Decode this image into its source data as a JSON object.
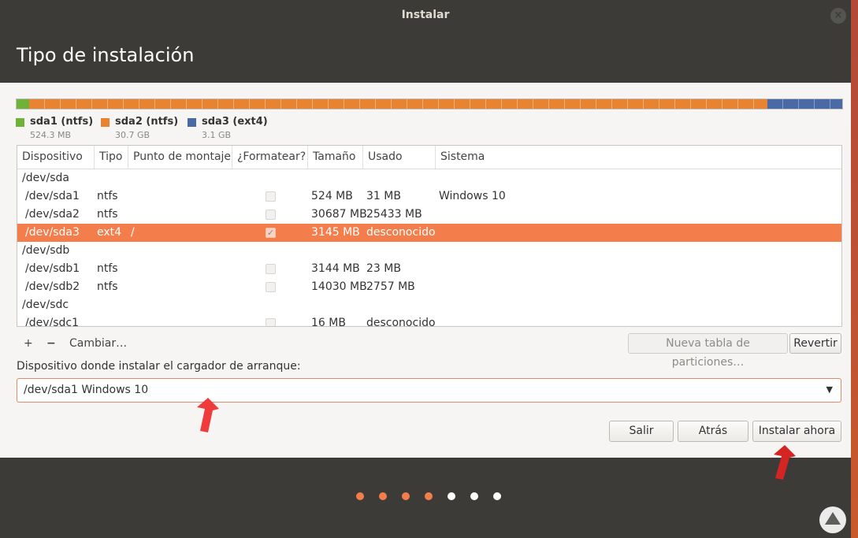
{
  "window": {
    "title": "Instalar",
    "close_glyph": "×"
  },
  "page": {
    "title": "Tipo de instalación"
  },
  "partitions_bar": [
    {
      "name": "sda1 (ntfs)",
      "size": "524.3 MB",
      "color": "#6fb23a",
      "fraction": 0.0152
    },
    {
      "name": "sda2 (ntfs)",
      "size": "30.7 GB",
      "color": "#e88332",
      "fraction": 0.894
    },
    {
      "name": "sda3 (ext4)",
      "size": "3.1 GB",
      "color": "#4a6aa5",
      "fraction": 0.0908
    }
  ],
  "table": {
    "columns": [
      "Dispositivo",
      "Tipo",
      "Punto de montaje",
      "¿Formatear?",
      "Tamaño",
      "Usado",
      "Sistema"
    ],
    "rows": [
      {
        "device": "/dev/sda",
        "group": true
      },
      {
        "device": "/dev/sda1",
        "type": "ntfs",
        "mount": "",
        "format": false,
        "size": "524 MB",
        "used": "31 MB",
        "system": "Windows 10"
      },
      {
        "device": "/dev/sda2",
        "type": "ntfs",
        "mount": "",
        "format": false,
        "size": "30687 MB",
        "used": "25433 MB",
        "system": ""
      },
      {
        "device": "/dev/sda3",
        "type": "ext4",
        "mount": "/",
        "format": true,
        "size": "3145 MB",
        "used": "desconocido",
        "system": "",
        "selected": true
      },
      {
        "device": "/dev/sdb",
        "group": true
      },
      {
        "device": "/dev/sdb1",
        "type": "ntfs",
        "mount": "",
        "format": false,
        "size": "3144 MB",
        "used": "23 MB",
        "system": ""
      },
      {
        "device": "/dev/sdb2",
        "type": "ntfs",
        "mount": "",
        "format": false,
        "size": "14030 MB",
        "used": "2757 MB",
        "system": ""
      },
      {
        "device": "/dev/sdc",
        "group": true
      },
      {
        "device": "/dev/sdc1",
        "type": "",
        "mount": "",
        "format": false,
        "size": "16 MB",
        "used": "desconocido",
        "system": ""
      }
    ]
  },
  "toolbar": {
    "add_label": "+",
    "remove_label": "−",
    "change_label": "Cambiar…",
    "new_table_label": "Nueva tabla de particiones…",
    "revert_label": "Revertir"
  },
  "bootloader": {
    "label": "Dispositivo donde instalar el cargador de arranque:",
    "value": "/dev/sda1 Windows 10",
    "arrow": "▼"
  },
  "actions": {
    "quit_label": "Salir",
    "back_label": "Atrás",
    "install_label": "Instalar ahora"
  },
  "progress": {
    "total_steps": 7,
    "completed_steps": 4,
    "done_color": "#f47d4c",
    "pending_color": "#ffffff"
  },
  "colors": {
    "accent": "#f47d4c",
    "annotation_arrow": "#ef3b3b",
    "window_bg": "#3c3b37"
  }
}
